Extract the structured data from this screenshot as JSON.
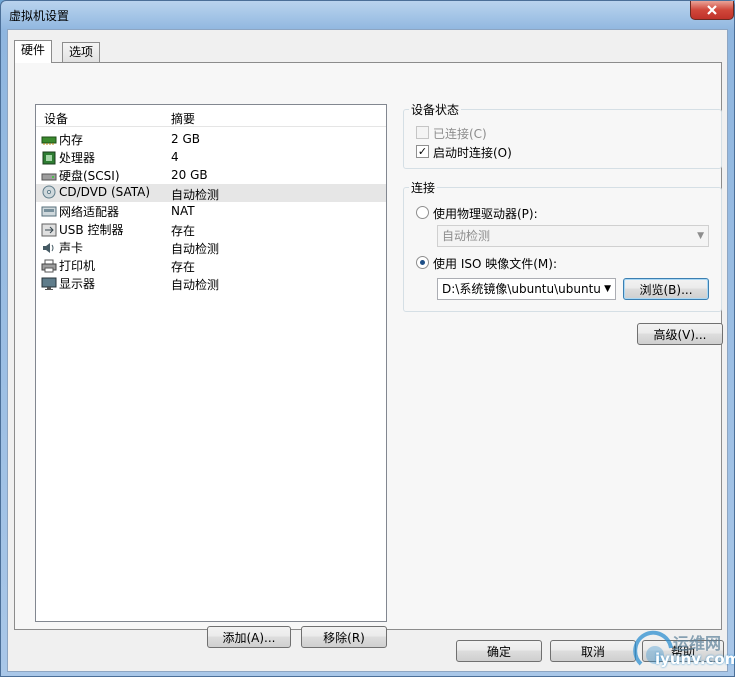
{
  "window": {
    "title": "虚拟机设置"
  },
  "tabs": [
    {
      "label": "硬件"
    },
    {
      "label": "选项"
    }
  ],
  "device_list": {
    "headers": {
      "device": "设备",
      "summary": "摘要"
    },
    "rows": [
      {
        "icon": "memory-icon",
        "name": "内存",
        "summary": "2 GB"
      },
      {
        "icon": "processor-icon",
        "name": "处理器",
        "summary": "4"
      },
      {
        "icon": "harddisk-icon",
        "name": "硬盘(SCSI)",
        "summary": "20 GB"
      },
      {
        "icon": "cd-dvd-icon",
        "name": "CD/DVD (SATA)",
        "summary": "自动检测"
      },
      {
        "icon": "network-adapter-icon",
        "name": "网络适配器",
        "summary": "NAT"
      },
      {
        "icon": "usb-icon",
        "name": "USB 控制器",
        "summary": "存在"
      },
      {
        "icon": "sound-card-icon",
        "name": "声卡",
        "summary": "自动检测"
      },
      {
        "icon": "printer-icon",
        "name": "打印机",
        "summary": "存在"
      },
      {
        "icon": "display-icon",
        "name": "显示器",
        "summary": "自动检测"
      }
    ],
    "selected_index": 3
  },
  "buttons": {
    "add": "添加(A)...",
    "remove": "移除(R)",
    "browse": "浏览(B)...",
    "advanced": "高级(V)...",
    "ok": "确定",
    "cancel": "取消",
    "help": "帮助"
  },
  "device_status": {
    "title": "设备状态",
    "connected": {
      "label": "已连接(C)",
      "checked": false,
      "disabled": true
    },
    "connect_at_power_on": {
      "label": "启动时连接(O)",
      "checked": true
    }
  },
  "connection": {
    "title": "连接",
    "physical_drive": {
      "label": "使用物理驱动器(P):",
      "selected": false
    },
    "physical_drive_combo": "自动检测",
    "iso_image": {
      "label": "使用 ISO 映像文件(M):",
      "selected": true
    },
    "iso_path": "D:\\系统镜像\\ubuntu\\ubuntu"
  },
  "watermark": {
    "line1": "运维网",
    "line2": "iyunv.com"
  },
  "colors": {
    "selection": "#e6e6e6",
    "window_frame": "#8fb6df",
    "close_button": "#d0473a"
  }
}
